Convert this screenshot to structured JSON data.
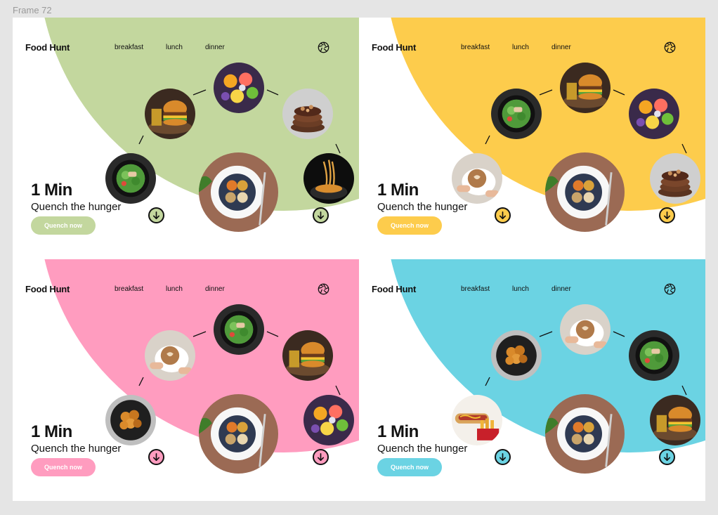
{
  "frame_label": "Frame 72",
  "brand": "Food Hunt",
  "nav": [
    "breakfast",
    "lunch",
    "dinner"
  ],
  "hero_title": "1 Min",
  "hero_subtitle": "Quench the hunger",
  "cta_label": "Quench now",
  "cards": [
    {
      "accent": "#c3d79e",
      "dishes": [
        "salad",
        "burger",
        "fruits",
        "pancakes",
        "noodles"
      ]
    },
    {
      "accent": "#fdcc4c",
      "dishes": [
        "coffee",
        "salad",
        "burger",
        "fruits",
        "pancakes"
      ]
    },
    {
      "accent": "#ff9cbf",
      "dishes": [
        "chicken",
        "coffee",
        "salad",
        "burger",
        "fruits"
      ]
    },
    {
      "accent": "#6bd3e3",
      "dishes": [
        "hotdog",
        "chicken",
        "coffee",
        "salad",
        "burger"
      ]
    }
  ],
  "icons": {
    "logo_mark": "shutter-icon",
    "scroll": "arrow-down-icon"
  }
}
